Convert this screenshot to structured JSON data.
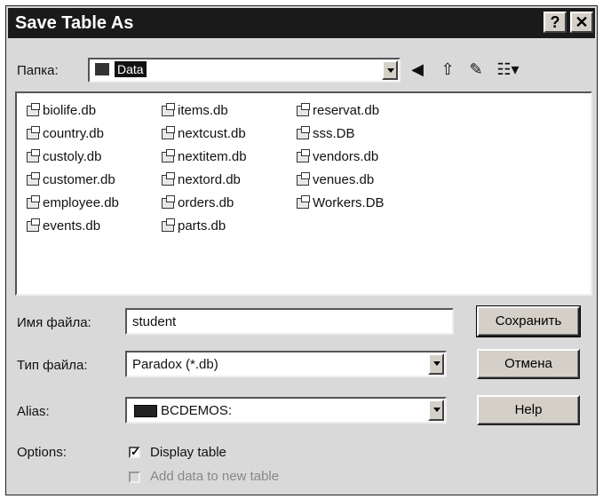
{
  "title": "Save Table As",
  "titlebar": {
    "help_label": "?",
    "close_label": "✕"
  },
  "folder": {
    "label": "Папка:",
    "value": "Data"
  },
  "toolbar": {
    "back_glyph": "◀",
    "up_glyph": "⇧",
    "newfolder_glyph": "✎",
    "view_glyph": "☷▾"
  },
  "files": {
    "col1": [
      "biolife.db",
      "country.db",
      "custoly.db",
      "customer.db",
      "employee.db",
      "events.db"
    ],
    "col2": [
      "items.db",
      "nextcust.db",
      "nextitem.db",
      "nextord.db",
      "orders.db",
      "parts.db"
    ],
    "col3": [
      "reservat.db",
      "sss.DB",
      "vendors.db",
      "venues.db",
      "Workers.DB"
    ]
  },
  "filename": {
    "label": "Имя файла:",
    "value": "student"
  },
  "filetype": {
    "label": "Тип файла:",
    "value": "Paradox (*.db)"
  },
  "alias": {
    "label": "Alias:",
    "value": "BCDEMOS:"
  },
  "options": {
    "label": "Options:",
    "display_table": "Display table",
    "add_data": "Add data to new table"
  },
  "buttons": {
    "save": "Сохранить",
    "cancel": "Отмена",
    "help": "Help"
  }
}
